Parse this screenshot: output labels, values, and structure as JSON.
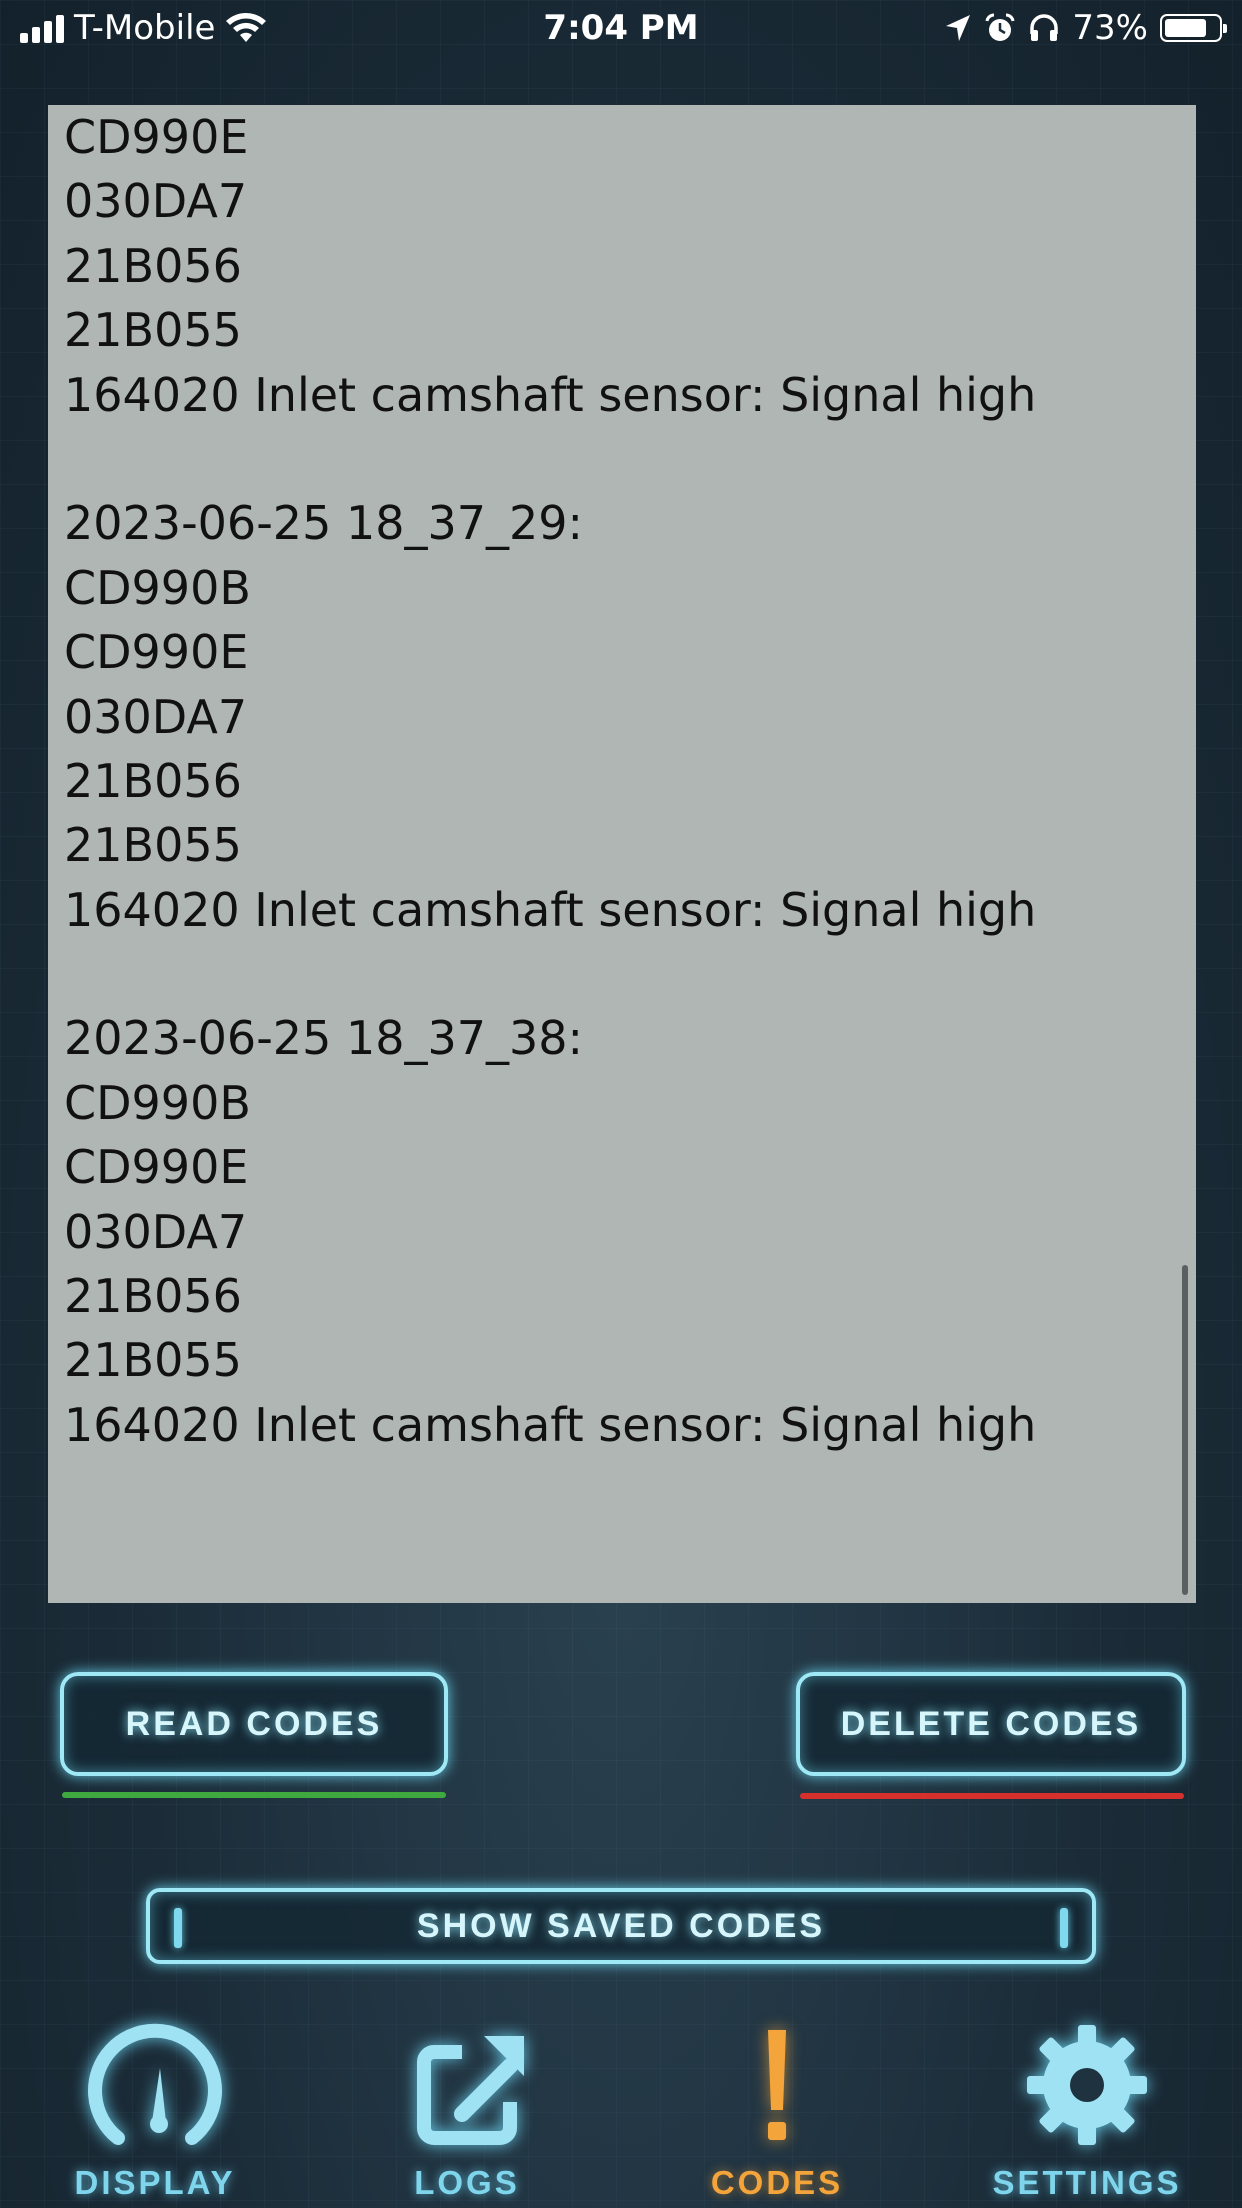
{
  "status_bar": {
    "carrier": "T-Mobile",
    "time": "7:04 PM",
    "battery": "73%",
    "battery_level": 0.73,
    "icons": [
      "signal-icon",
      "wifi-icon",
      "location-icon",
      "alarm-icon",
      "headphones-icon",
      "battery-icon"
    ]
  },
  "log": {
    "lines": [
      "CD990E",
      "030DA7",
      "21B056",
      "21B055",
      "164020 Inlet camshaft sensor: Signal high",
      "",
      "2023-06-25 18_37_29:",
      "CD990B",
      "CD990E",
      "030DA7",
      "21B056",
      "21B055",
      "164020 Inlet camshaft sensor: Signal high",
      "",
      "2023-06-25 18_37_38:",
      "CD990B",
      "CD990E",
      "030DA7",
      "21B056",
      "21B055",
      "164020 Inlet camshaft sensor: Signal high"
    ]
  },
  "buttons": {
    "read_codes": "READ CODES",
    "delete_codes": "DELETE CODES",
    "show_saved_codes": "SHOW SAVED CODES"
  },
  "tabs": [
    {
      "label": "DISPLAY",
      "icon": "gauge-icon",
      "active": false
    },
    {
      "label": "LOGS",
      "icon": "share-icon",
      "active": false
    },
    {
      "label": "CODES",
      "icon": "exclamation-icon",
      "active": true
    },
    {
      "label": "SETTINGS",
      "icon": "gear-icon",
      "active": false
    }
  ],
  "colors": {
    "accent": "#9fe8f6",
    "active_tab": "#f3a43a",
    "read_underline": "#3fa93f",
    "delete_underline": "#d6302d",
    "log_background": "#afb6b4"
  }
}
